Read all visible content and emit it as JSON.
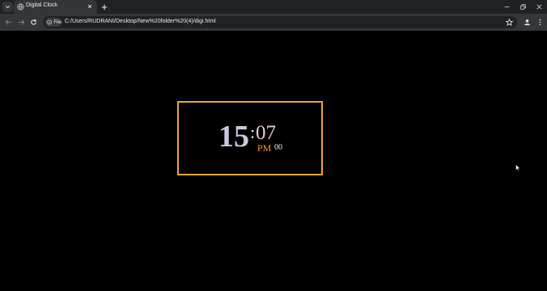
{
  "browser": {
    "tab": {
      "title": "Digital Clock"
    },
    "omnibox": {
      "scheme_label": "File",
      "url": "C:/Users/RUDRANI/Desktop/New%20folder%20(4)/digi.html"
    },
    "icons": {
      "tab_search": "chevron-down-icon",
      "favicon": "globe-icon",
      "tab_close": "close-icon",
      "new_tab": "plus-icon",
      "back": "arrow-left-icon",
      "forward": "arrow-right-icon",
      "reload": "reload-icon",
      "site_info": "info-icon",
      "bookmark": "star-icon",
      "profile": "person-icon",
      "menu": "kebab-menu-icon",
      "minimize": "minimize-icon",
      "restore": "restore-icon",
      "close_window": "close-icon"
    }
  },
  "clock": {
    "hours": "15",
    "separator": ":",
    "minutes": "07",
    "period": "PM",
    "seconds": "00"
  },
  "colors": {
    "page_background": "#000000",
    "clock_border": "#e9a633",
    "hours": "#c8c8e0",
    "minutes": "#e9c8d8",
    "period": "#f39a2b"
  }
}
